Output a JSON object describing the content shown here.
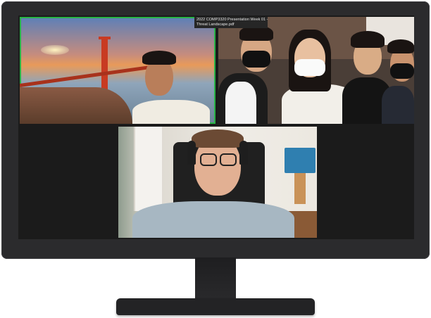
{
  "screen": {
    "shared_file_label_line1": "2022 COMP3320 Presentation Week 01 -",
    "shared_file_label_line2": "Threat Landscape.pdf"
  },
  "tiles": [
    {
      "name": "participant-tile-golden-gate",
      "active_speaker": true,
      "highlight_color": "#28b446"
    },
    {
      "name": "participant-tile-group"
    },
    {
      "name": "participant-tile-headset"
    }
  ],
  "colors": {
    "monitor_bezel": "#2b2b2d",
    "screen_background": "#1b1b1b"
  }
}
